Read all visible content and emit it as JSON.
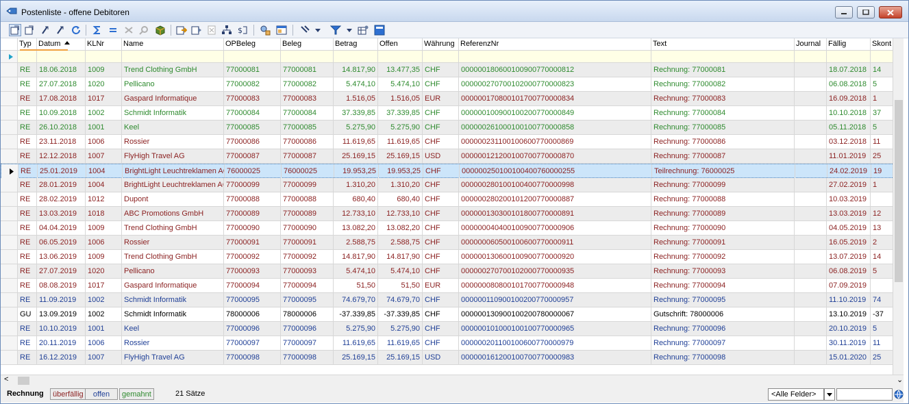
{
  "window": {
    "title": "Postenliste - offene Debitoren"
  },
  "colors": {
    "blue": "#1f3f96",
    "green": "#2e8a2e",
    "red": "#8a1f1f",
    "black": "#000000"
  },
  "columns": [
    "Typ",
    "Datum",
    "KLNr",
    "Name",
    "OPBeleg",
    "Beleg",
    "Betrag",
    "Offen",
    "Währung",
    "ReferenzNr",
    "Text",
    "Journal",
    "Fällig",
    "Skont"
  ],
  "rows": [
    {
      "typ": "RE",
      "datum": "18.06.2018",
      "klnr": "1009",
      "name": "Trend Clothing GmbH",
      "opbeleg": "77000081",
      "beleg": "77000081",
      "betrag": "14.817,90",
      "offen": "13.477,35",
      "waehrung": "CHF",
      "referenz": "000000180600100900770000812",
      "text": "Rechnung: 77000081",
      "journal": "",
      "faellig": "18.07.2018",
      "skont": "14",
      "color": "green"
    },
    {
      "typ": "RE",
      "datum": "27.07.2018",
      "klnr": "1020",
      "name": "Pellicano",
      "opbeleg": "77000082",
      "beleg": "77000082",
      "betrag": "5.474,10",
      "offen": "5.474,10",
      "waehrung": "CHF",
      "referenz": "000000270700102000770000823",
      "text": "Rechnung: 77000082",
      "journal": "",
      "faellig": "06.08.2018",
      "skont": "5",
      "color": "green"
    },
    {
      "typ": "RE",
      "datum": "17.08.2018",
      "klnr": "1017",
      "name": "Gaspard Informatique",
      "opbeleg": "77000083",
      "beleg": "77000083",
      "betrag": "1.516,05",
      "offen": "1.516,05",
      "waehrung": "EUR",
      "referenz": "000000170800101700770000834",
      "text": "Rechnung: 77000083",
      "journal": "",
      "faellig": "16.09.2018",
      "skont": "1",
      "color": "red"
    },
    {
      "typ": "RE",
      "datum": "10.09.2018",
      "klnr": "1002",
      "name": "Schmidt Informatik",
      "opbeleg": "77000084",
      "beleg": "77000084",
      "betrag": "37.339,85",
      "offen": "37.339,85",
      "waehrung": "CHF",
      "referenz": "000000100900100200770000849",
      "text": "Rechnung: 77000084",
      "journal": "",
      "faellig": "10.10.2018",
      "skont": "37",
      "color": "green"
    },
    {
      "typ": "RE",
      "datum": "26.10.2018",
      "klnr": "1001",
      "name": "Keel",
      "opbeleg": "77000085",
      "beleg": "77000085",
      "betrag": "5.275,90",
      "offen": "5.275,90",
      "waehrung": "CHF",
      "referenz": "000000261000100100770000858",
      "text": "Rechnung: 77000085",
      "journal": "",
      "faellig": "05.11.2018",
      "skont": "5",
      "color": "green"
    },
    {
      "typ": "RE",
      "datum": "23.11.2018",
      "klnr": "1006",
      "name": "Rossier",
      "opbeleg": "77000086",
      "beleg": "77000086",
      "betrag": "11.619,65",
      "offen": "11.619,65",
      "waehrung": "CHF",
      "referenz": "000000231100100600770000869",
      "text": "Rechnung: 77000086",
      "journal": "",
      "faellig": "03.12.2018",
      "skont": "11",
      "color": "red"
    },
    {
      "typ": "RE",
      "datum": "12.12.2018",
      "klnr": "1007",
      "name": "FlyHigh Travel AG",
      "opbeleg": "77000087",
      "beleg": "77000087",
      "betrag": "25.169,15",
      "offen": "25.169,15",
      "waehrung": "USD",
      "referenz": "000000121200100700770000870",
      "text": "Rechnung: 77000087",
      "journal": "",
      "faellig": "11.01.2019",
      "skont": "25",
      "color": "red"
    },
    {
      "typ": "RE",
      "datum": "25.01.2019",
      "klnr": "1004",
      "name": "BrightLight Leuchtreklamen AG",
      "opbeleg": "76000025",
      "beleg": "76000025",
      "betrag": "19.953,25",
      "offen": "19.953,25",
      "waehrung": "CHF",
      "referenz": "000000250100100400760000255",
      "text": "Teilrechnung: 76000025",
      "journal": "",
      "faellig": "24.02.2019",
      "skont": "19",
      "color": "red",
      "selected": true
    },
    {
      "typ": "RE",
      "datum": "28.01.2019",
      "klnr": "1004",
      "name": "BrightLight Leuchtreklamen AG",
      "opbeleg": "77000099",
      "beleg": "77000099",
      "betrag": "1.310,20",
      "offen": "1.310,20",
      "waehrung": "CHF",
      "referenz": "000000280100100400770000998",
      "text": "Rechnung: 77000099",
      "journal": "",
      "faellig": "27.02.2019",
      "skont": "1",
      "color": "red"
    },
    {
      "typ": "RE",
      "datum": "28.02.2019",
      "klnr": "1012",
      "name": "Dupont",
      "opbeleg": "77000088",
      "beleg": "77000088",
      "betrag": "680,40",
      "offen": "680,40",
      "waehrung": "CHF",
      "referenz": "000000280200101200770000887",
      "text": "Rechnung: 77000088",
      "journal": "",
      "faellig": "10.03.2019",
      "skont": "",
      "color": "red"
    },
    {
      "typ": "RE",
      "datum": "13.03.2019",
      "klnr": "1018",
      "name": "ABC Promotions GmbH",
      "opbeleg": "77000089",
      "beleg": "77000089",
      "betrag": "12.733,10",
      "offen": "12.733,10",
      "waehrung": "CHF",
      "referenz": "000000130300101800770000891",
      "text": "Rechnung: 77000089",
      "journal": "",
      "faellig": "13.03.2019",
      "skont": "12",
      "color": "red"
    },
    {
      "typ": "RE",
      "datum": "04.04.2019",
      "klnr": "1009",
      "name": "Trend Clothing GmbH",
      "opbeleg": "77000090",
      "beleg": "77000090",
      "betrag": "13.082,20",
      "offen": "13.082,20",
      "waehrung": "CHF",
      "referenz": "000000040400100900770000906",
      "text": "Rechnung: 77000090",
      "journal": "",
      "faellig": "04.05.2019",
      "skont": "13",
      "color": "red"
    },
    {
      "typ": "RE",
      "datum": "06.05.2019",
      "klnr": "1006",
      "name": "Rossier",
      "opbeleg": "77000091",
      "beleg": "77000091",
      "betrag": "2.588,75",
      "offen": "2.588,75",
      "waehrung": "CHF",
      "referenz": "000000060500100600770000911",
      "text": "Rechnung: 77000091",
      "journal": "",
      "faellig": "16.05.2019",
      "skont": "2",
      "color": "red"
    },
    {
      "typ": "RE",
      "datum": "13.06.2019",
      "klnr": "1009",
      "name": "Trend Clothing GmbH",
      "opbeleg": "77000092",
      "beleg": "77000092",
      "betrag": "14.817,90",
      "offen": "14.817,90",
      "waehrung": "CHF",
      "referenz": "000000130600100900770000920",
      "text": "Rechnung: 77000092",
      "journal": "",
      "faellig": "13.07.2019",
      "skont": "14",
      "color": "red"
    },
    {
      "typ": "RE",
      "datum": "27.07.2019",
      "klnr": "1020",
      "name": "Pellicano",
      "opbeleg": "77000093",
      "beleg": "77000093",
      "betrag": "5.474,10",
      "offen": "5.474,10",
      "waehrung": "CHF",
      "referenz": "000000270700102000770000935",
      "text": "Rechnung: 77000093",
      "journal": "",
      "faellig": "06.08.2019",
      "skont": "5",
      "color": "red"
    },
    {
      "typ": "RE",
      "datum": "08.08.2019",
      "klnr": "1017",
      "name": "Gaspard Informatique",
      "opbeleg": "77000094",
      "beleg": "77000094",
      "betrag": "51,50",
      "offen": "51,50",
      "waehrung": "EUR",
      "referenz": "000000080800101700770000948",
      "text": "Rechnung: 77000094",
      "journal": "",
      "faellig": "07.09.2019",
      "skont": "",
      "color": "red"
    },
    {
      "typ": "RE",
      "datum": "11.09.2019",
      "klnr": "1002",
      "name": "Schmidt Informatik",
      "opbeleg": "77000095",
      "beleg": "77000095",
      "betrag": "74.679,70",
      "offen": "74.679,70",
      "waehrung": "CHF",
      "referenz": "000000110900100200770000957",
      "text": "Rechnung: 77000095",
      "journal": "",
      "faellig": "11.10.2019",
      "skont": "74",
      "color": "blue"
    },
    {
      "typ": "GU",
      "datum": "13.09.2019",
      "klnr": "1002",
      "name": "Schmidt Informatik",
      "opbeleg": "78000006",
      "beleg": "78000006",
      "betrag": "-37.339,85",
      "offen": "-37.339,85",
      "waehrung": "CHF",
      "referenz": "000000130900100200780000067",
      "text": "Gutschrift: 78000006",
      "journal": "",
      "faellig": "13.10.2019",
      "skont": "-37",
      "color": "black"
    },
    {
      "typ": "RE",
      "datum": "10.10.2019",
      "klnr": "1001",
      "name": "Keel",
      "opbeleg": "77000096",
      "beleg": "77000096",
      "betrag": "5.275,90",
      "offen": "5.275,90",
      "waehrung": "CHF",
      "referenz": "000000101000100100770000965",
      "text": "Rechnung: 77000096",
      "journal": "",
      "faellig": "20.10.2019",
      "skont": "5",
      "color": "blue"
    },
    {
      "typ": "RE",
      "datum": "20.11.2019",
      "klnr": "1006",
      "name": "Rossier",
      "opbeleg": "77000097",
      "beleg": "77000097",
      "betrag": "11.619,65",
      "offen": "11.619,65",
      "waehrung": "CHF",
      "referenz": "000000201100100600770000979",
      "text": "Rechnung: 77000097",
      "journal": "",
      "faellig": "30.11.2019",
      "skont": "11",
      "color": "blue"
    },
    {
      "typ": "RE",
      "datum": "16.12.2019",
      "klnr": "1007",
      "name": "FlyHigh Travel AG",
      "opbeleg": "77000098",
      "beleg": "77000098",
      "betrag": "25.169,15",
      "offen": "25.169,15",
      "waehrung": "USD",
      "referenz": "000000161200100700770000983",
      "text": "Rechnung: 77000098",
      "journal": "",
      "faellig": "15.01.2020",
      "skont": "25",
      "color": "blue"
    }
  ],
  "status": {
    "legend_rechnung": "Rechnung",
    "legend_ueberfaellig": "überfällig",
    "legend_offen": "offen",
    "legend_gemahnt": "gemahnt",
    "count": "21 Sätze",
    "field_select": "<Alle Felder>",
    "search_value": ""
  }
}
